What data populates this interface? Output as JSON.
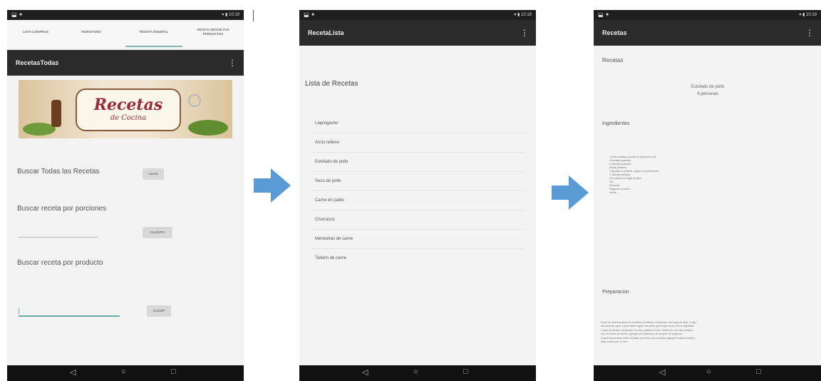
{
  "status": {
    "left_icons": "⬓ ✦",
    "right_text": "▾ ▮ 10:19"
  },
  "screen1": {
    "tabs": [
      "LISTA COMPRAS",
      "INVENTARIO",
      "RECETA GENERAL",
      "RECETA SEGÚN TUS PRODUCTOS"
    ],
    "appbar_title": "RecetasTodas",
    "menu_icon": "⋮",
    "banner": {
      "title": "Recetas",
      "subtitle": "de Cocina"
    },
    "buscar_todas_label": "Buscar Todas las Recetas",
    "buscar_todas_btn": "CLICK",
    "buscar_porciones_label": "Buscar receta por porciones",
    "buscar_porciones_btn": "CLICKPO",
    "buscar_producto_label": "Buscar receta por producto",
    "buscar_producto_btn": "CLICKP"
  },
  "screen2": {
    "appbar_title": "RecetaLista",
    "menu_icon": "⋮",
    "heading": "Lista de Recetas",
    "items": [
      "Llapingacho",
      "Arroz relleno",
      "Estofado de pollo",
      "Seco de pollo",
      "Carne en palito",
      "Churrasco",
      "Menestras de carne",
      "Tallarin de carne"
    ]
  },
  "screen3": {
    "appbar_title": "Recetas",
    "menu_icon": "⋮",
    "section_title": "Recetas",
    "recipe_name": "Estofado de pollo",
    "recipe_servings": "4 personas",
    "ingredients_label": "Ingredientes",
    "ingredients": [
      "1 pollo mediano picado en presas sin piel",
      "3 tomates grandes",
      "2 cebollas grandes",
      "Media pimiento",
      "1 aji (titaro o picante, según su preferencia)",
      "1 cebolla mediana",
      "Un puñado de hojas de apio",
      "Sal",
      "Pimienta",
      "Palguera en polvo",
      "Aceite"
    ],
    "prep_label": "Preparacion",
    "prep_lines": [
      "Poner en una licuadora los tomates, la cebolla, el pimiento, las hojas de apio, el aji y",
      "una taza de agua. Licuar hasta lograr una salsa que tenga trozos de los vegetales.",
      "Luego de licuarlo, despresar el pollo y quitarle la piel, sofreír en una olla mediana",
      "con un chorro de aceite. Agregar sal, pimienta y un poquito de palguera.",
      "Cuando las presas estén doradas por todos sus costados agrega la salsa licuada y",
      "deja cocinar por 15 min."
    ]
  },
  "navbar": {
    "back": "◁",
    "home": "○",
    "recents": "□"
  },
  "colors": {
    "appbar": "#2b2b2b",
    "accent": "#64b0a2",
    "arrow": "#5b9bd5",
    "title_red": "#9a2c3a"
  }
}
